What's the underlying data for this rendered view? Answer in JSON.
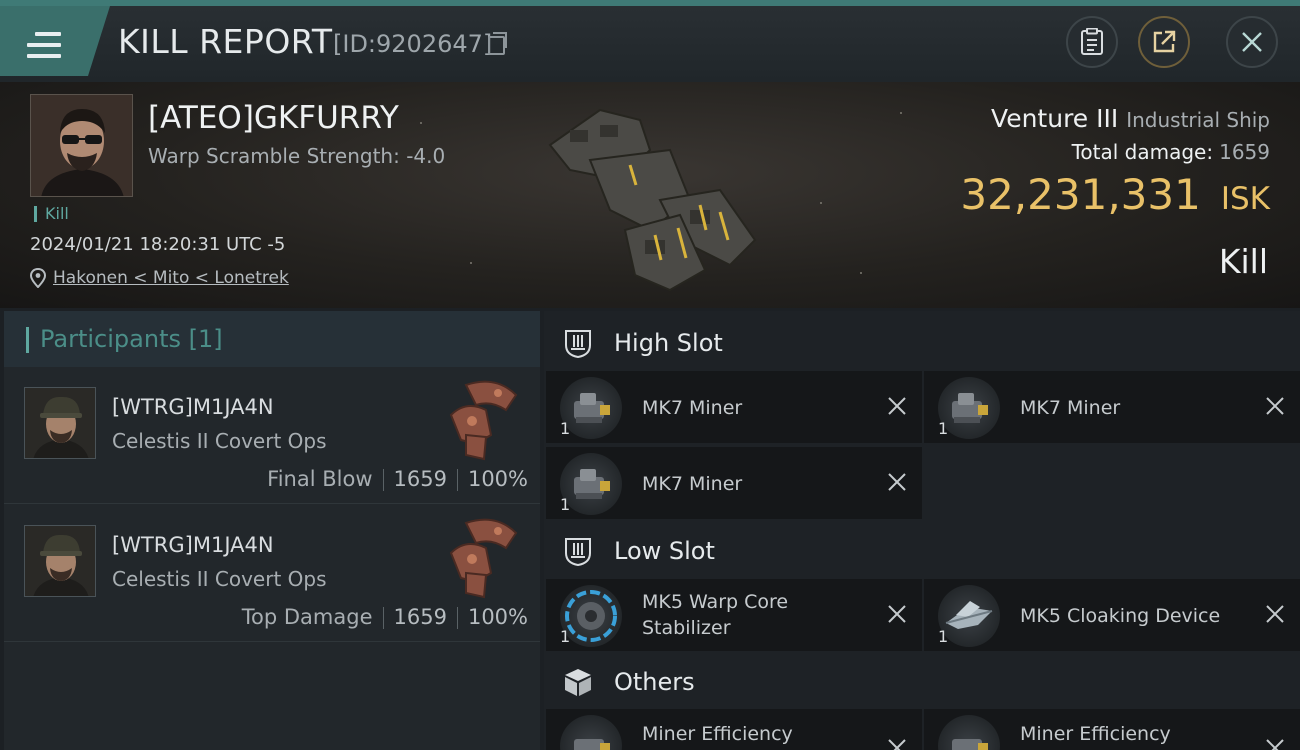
{
  "header": {
    "title": "KILL REPORT",
    "report_id": "[ID:9202647]",
    "menu_icon": "hamburger-menu-icon",
    "buttons": [
      "clipboard-icon",
      "share-icon",
      "close-icon"
    ]
  },
  "victim": {
    "name": "[ATEO]GKFURRY",
    "warp_scramble": "Warp Scramble Strength: -4.0",
    "tag": "Kill",
    "datetime": "2024/01/21 18:20:31 UTC -5",
    "location": "Hakonen < Mito < Lonetrek",
    "ship_name": "Venture III",
    "ship_class": "Industrial Ship",
    "total_damage_label": "Total damage:",
    "total_damage": "1659",
    "isk_value": "32,231,331",
    "isk_unit": "ISK",
    "result": "Kill"
  },
  "participants": {
    "title": "Participants [1]",
    "rows": [
      {
        "name": "[WTRG]M1JA4N",
        "ship": "Celestis II Covert Ops",
        "label": "Final Blow",
        "damage": "1659",
        "percent": "100%"
      },
      {
        "name": "[WTRG]M1JA4N",
        "ship": "Celestis II Covert Ops",
        "label": "Top Damage",
        "damage": "1659",
        "percent": "100%"
      }
    ]
  },
  "fittings": {
    "high_slot": {
      "label": "High Slot",
      "items": [
        {
          "name": "MK7 Miner",
          "qty": "1"
        },
        {
          "name": "MK7 Miner",
          "qty": "1"
        },
        {
          "name": "MK7 Miner",
          "qty": "1"
        }
      ]
    },
    "low_slot": {
      "label": "Low Slot",
      "items": [
        {
          "name": "MK5 Warp Core Stabilizer",
          "qty": "1"
        },
        {
          "name": "MK5 Cloaking Device",
          "qty": "1"
        }
      ]
    },
    "others": {
      "label": "Others",
      "items": [
        {
          "name": "Miner Efficiency"
        },
        {
          "name": "Miner Efficiency"
        }
      ]
    }
  },
  "colors": {
    "accent_teal": "#5fa8a0",
    "isk_gold": "#e9c168",
    "background": "#1c2024"
  }
}
